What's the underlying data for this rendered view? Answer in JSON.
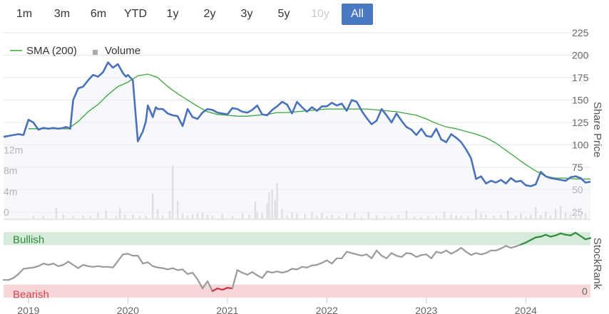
{
  "range_selector": {
    "buttons": [
      {
        "label": "1m",
        "state": "normal"
      },
      {
        "label": "3m",
        "state": "normal"
      },
      {
        "label": "6m",
        "state": "normal"
      },
      {
        "label": "YTD",
        "state": "normal"
      },
      {
        "label": "1y",
        "state": "normal"
      },
      {
        "label": "2y",
        "state": "normal"
      },
      {
        "label": "3y",
        "state": "normal"
      },
      {
        "label": "5y",
        "state": "normal"
      },
      {
        "label": "10y",
        "state": "disabled"
      },
      {
        "label": "All",
        "state": "active"
      }
    ]
  },
  "colors": {
    "price_line": "#4a72b8",
    "price_fill": "#eef2fa",
    "sma_line": "#3aa63a",
    "volume_bar": "#c8c8c8",
    "bullish_zone": "#d6ebd9",
    "bearish_zone": "#f6d6d9",
    "bullish_text": "#2e8b3a",
    "bearish_text": "#d0454f",
    "rank_neutral": "#9a9a9a",
    "rank_bull": "#2e8b3a",
    "rank_bear": "#c8323e",
    "active_button": "#4a78c2"
  },
  "chart_data": [
    {
      "type": "line",
      "name": "price-panel",
      "legend": [
        {
          "label": "SMA (200)",
          "icon": "line-swatch"
        },
        {
          "label": "Volume",
          "icon": "square-swatch"
        }
      ],
      "y_axis_title": "Share Price",
      "y_ticks": [
        "225",
        "200",
        "175",
        "150",
        "125",
        "100",
        "75",
        "50",
        "25"
      ],
      "ylim": [
        25,
        225
      ],
      "volume_ticks": [
        "12m",
        "8m",
        "4m",
        "0"
      ],
      "volume_ylim": [
        0,
        16
      ],
      "x_ticks": [
        "2019",
        "2020",
        "2021",
        "2022",
        "2023",
        "2024"
      ],
      "xlim": [
        2018.75,
        2024.65
      ],
      "series": [
        {
          "name": "Price",
          "x": [
            2018.75,
            2018.8,
            2018.85,
            2018.9,
            2018.95,
            2019.0,
            2019.05,
            2019.1,
            2019.15,
            2019.2,
            2019.25,
            2019.3,
            2019.35,
            2019.38,
            2019.42,
            2019.45,
            2019.5,
            2019.55,
            2019.6,
            2019.65,
            2019.7,
            2019.75,
            2019.8,
            2019.85,
            2019.9,
            2019.95,
            2019.98,
            2020.0,
            2020.05,
            2020.1,
            2020.15,
            2020.18,
            2020.2,
            2020.22,
            2020.25,
            2020.28,
            2020.3,
            2020.35,
            2020.4,
            2020.45,
            2020.5,
            2020.55,
            2020.6,
            2020.65,
            2020.7,
            2020.75,
            2020.8,
            2020.85,
            2020.9,
            2020.95,
            2021.0,
            2021.05,
            2021.1,
            2021.15,
            2021.2,
            2021.25,
            2021.3,
            2021.35,
            2021.4,
            2021.45,
            2021.5,
            2021.55,
            2021.6,
            2021.65,
            2021.7,
            2021.75,
            2021.8,
            2021.85,
            2021.9,
            2021.95,
            2022.0,
            2022.05,
            2022.1,
            2022.15,
            2022.2,
            2022.25,
            2022.3,
            2022.35,
            2022.4,
            2022.45,
            2022.5,
            2022.55,
            2022.6,
            2022.65,
            2022.7,
            2022.75,
            2022.8,
            2022.85,
            2022.9,
            2022.95,
            2023.0,
            2023.05,
            2023.1,
            2023.15,
            2023.2,
            2023.25,
            2023.3,
            2023.35,
            2023.4,
            2023.45,
            2023.5,
            2023.55,
            2023.6,
            2023.65,
            2023.7,
            2023.75,
            2023.8,
            2023.85,
            2023.9,
            2023.95,
            2024.0,
            2024.05,
            2024.1,
            2024.15,
            2024.2,
            2024.25,
            2024.3,
            2024.35,
            2024.4,
            2024.45,
            2024.5,
            2024.55,
            2024.6,
            2024.65
          ],
          "y": [
            109,
            110,
            111,
            112,
            111,
            128,
            125,
            117,
            119,
            118,
            119,
            118,
            119,
            120,
            118,
            150,
            163,
            165,
            172,
            178,
            176,
            181,
            192,
            186,
            190,
            180,
            176,
            178,
            172,
            104,
            115,
            126,
            144,
            139,
            131,
            142,
            140,
            140,
            135,
            133,
            132,
            121,
            140,
            131,
            129,
            136,
            140,
            139,
            136,
            135,
            134,
            141,
            140,
            137,
            136,
            139,
            144,
            134,
            133,
            139,
            143,
            148,
            145,
            135,
            148,
            142,
            137,
            142,
            138,
            143,
            143,
            147,
            144,
            146,
            138,
            150,
            148,
            138,
            130,
            123,
            127,
            140,
            133,
            125,
            135,
            127,
            120,
            117,
            111,
            118,
            110,
            109,
            118,
            106,
            103,
            112,
            108,
            103,
            95,
            85,
            62,
            65,
            57,
            60,
            58,
            61,
            57,
            63,
            59,
            60,
            55,
            54,
            56,
            70,
            65,
            63,
            62,
            61,
            60,
            64,
            65,
            63,
            58,
            59
          ],
          "color_key": "price_line"
        },
        {
          "name": "SMA (200)",
          "x": [
            2019.0,
            2019.2,
            2019.4,
            2019.5,
            2019.6,
            2019.7,
            2019.8,
            2019.9,
            2020.0,
            2020.1,
            2020.2,
            2020.3,
            2020.4,
            2020.5,
            2020.6,
            2020.7,
            2020.8,
            2020.9,
            2021.0,
            2021.1,
            2021.2,
            2021.3,
            2021.4,
            2021.5,
            2021.6,
            2021.7,
            2021.8,
            2021.9,
            2022.0,
            2022.1,
            2022.2,
            2022.3,
            2022.4,
            2022.5,
            2022.6,
            2022.7,
            2022.8,
            2022.9,
            2023.0,
            2023.1,
            2023.2,
            2023.3,
            2023.4,
            2023.5,
            2023.6,
            2023.7,
            2023.8,
            2023.9,
            2024.0,
            2024.1,
            2024.2,
            2024.3,
            2024.4,
            2024.5,
            2024.65
          ],
          "y": [
            118,
            118,
            118,
            126,
            137,
            145,
            156,
            165,
            170,
            177,
            179,
            175,
            165,
            157,
            150,
            143,
            137,
            134,
            133,
            132,
            132,
            133,
            134,
            136,
            136,
            137,
            138,
            139,
            140,
            140,
            140,
            140,
            140,
            139,
            138,
            137,
            135,
            133,
            129,
            124,
            120,
            118,
            115,
            112,
            108,
            102,
            94,
            86,
            78,
            71,
            65,
            63,
            63,
            62,
            62
          ],
          "color_key": "sma_line"
        }
      ],
      "volume": {
        "x": [
          2019.05,
          2019.15,
          2019.28,
          2019.35,
          2019.45,
          2019.55,
          2019.62,
          2019.7,
          2019.78,
          2019.88,
          2019.92,
          2019.97,
          2020.05,
          2020.12,
          2020.18,
          2020.25,
          2020.3,
          2020.35,
          2020.42,
          2020.45,
          2020.5,
          2020.55,
          2020.6,
          2020.65,
          2020.7,
          2020.75,
          2020.8,
          2020.85,
          2020.95,
          2021.05,
          2021.15,
          2021.22,
          2021.28,
          2021.3,
          2021.35,
          2021.4,
          2021.42,
          2021.45,
          2021.48,
          2021.5,
          2021.55,
          2021.6,
          2021.65,
          2021.7,
          2021.78,
          2021.85,
          2021.9,
          2021.95,
          2022.0,
          2022.05,
          2022.12,
          2022.2,
          2022.28,
          2022.35,
          2022.42,
          2022.5,
          2022.58,
          2022.65,
          2022.72,
          2022.8,
          2022.88,
          2022.95,
          2023.02,
          2023.1,
          2023.18,
          2023.25,
          2023.3,
          2023.35,
          2023.42,
          2023.5,
          2023.55,
          2023.6,
          2023.68,
          2023.75,
          2023.82,
          2023.9,
          2023.95,
          2024.0,
          2024.05,
          2024.1,
          2024.15,
          2024.2,
          2024.25,
          2024.3,
          2024.35,
          2024.4,
          2024.45,
          2024.5,
          2024.55,
          2024.6
        ],
        "values": [
          0.6,
          0.5,
          2.0,
          0.8,
          0.5,
          0.6,
          0.4,
          1.1,
          1.6,
          0.5,
          2.1,
          0.7,
          0.8,
          0.4,
          0.5,
          4.8,
          1.8,
          0.6,
          1.5,
          10.2,
          3.4,
          1.0,
          0.6,
          0.8,
          1.0,
          1.2,
          0.7,
          0.6,
          0.9,
          0.5,
          1.0,
          0.8,
          3.3,
          1.2,
          1.1,
          2.9,
          5.0,
          5.5,
          3.6,
          6.8,
          1.9,
          0.6,
          1.3,
          1.0,
          0.9,
          1.2,
          0.6,
          1.1,
          0.4,
          0.8,
          0.4,
          0.9,
          1.1,
          0.3,
          1.3,
          0.6,
          0.4,
          0.5,
          0.7,
          1.5,
          0.4,
          0.3,
          0.5,
          0.6,
          1.4,
          0.9,
          0.6,
          0.5,
          0.4,
          1.9,
          1.0,
          0.7,
          0.6,
          0.8,
          1.5,
          0.6,
          1.0,
          0.4,
          0.8,
          2.2,
          0.7,
          1.3,
          0.6,
          1.8,
          2.4,
          1.2,
          0.9,
          1.6,
          0.7,
          1.0
        ],
        "color_key": "volume_bar"
      }
    },
    {
      "type": "line",
      "name": "stockrank-panel",
      "y_axis_title": "StockRank",
      "y_ticks": [
        "0"
      ],
      "ylim": [
        0,
        100
      ],
      "zones": [
        {
          "label": "Bullish",
          "from": 80,
          "to": 100,
          "color_key": "bullish_zone",
          "text_color_key": "bullish_text"
        },
        {
          "label": "Bearish",
          "from": 0,
          "to": 20,
          "color_key": "bearish_zone",
          "text_color_key": "bearish_text"
        }
      ],
      "x": [
        2018.75,
        2018.8,
        2018.85,
        2018.9,
        2018.95,
        2019.0,
        2019.05,
        2019.1,
        2019.15,
        2019.2,
        2019.25,
        2019.3,
        2019.35,
        2019.4,
        2019.45,
        2019.5,
        2019.55,
        2019.6,
        2019.65,
        2019.7,
        2019.75,
        2019.8,
        2019.85,
        2019.9,
        2019.95,
        2020.0,
        2020.05,
        2020.1,
        2020.15,
        2020.2,
        2020.25,
        2020.3,
        2020.35,
        2020.4,
        2020.45,
        2020.5,
        2020.55,
        2020.6,
        2020.65,
        2020.7,
        2020.75,
        2020.8,
        2020.85,
        2020.9,
        2020.95,
        2021.0,
        2021.05,
        2021.1,
        2021.15,
        2021.2,
        2021.25,
        2021.3,
        2021.35,
        2021.4,
        2021.45,
        2021.5,
        2021.55,
        2021.6,
        2021.65,
        2021.7,
        2021.75,
        2021.8,
        2021.85,
        2021.9,
        2021.95,
        2022.0,
        2022.05,
        2022.1,
        2022.15,
        2022.2,
        2022.25,
        2022.3,
        2022.35,
        2022.4,
        2022.45,
        2022.5,
        2022.55,
        2022.6,
        2022.65,
        2022.7,
        2022.75,
        2022.8,
        2022.85,
        2022.9,
        2022.95,
        2023.0,
        2023.05,
        2023.1,
        2023.15,
        2023.2,
        2023.25,
        2023.3,
        2023.35,
        2023.4,
        2023.45,
        2023.5,
        2023.55,
        2023.6,
        2023.65,
        2023.7,
        2023.75,
        2023.8,
        2023.85,
        2023.9,
        2023.95,
        2024.0,
        2024.05,
        2024.1,
        2024.15,
        2024.2,
        2024.25,
        2024.3,
        2024.35,
        2024.4,
        2024.45,
        2024.5,
        2024.55,
        2024.6,
        2024.65
      ],
      "values": [
        27,
        27,
        30,
        36,
        44,
        45,
        46,
        48,
        52,
        50,
        52,
        48,
        50,
        55,
        50,
        45,
        50,
        48,
        47,
        48,
        47,
        47,
        46,
        56,
        66,
        67,
        64,
        64,
        52,
        54,
        48,
        46,
        45,
        43,
        45,
        42,
        43,
        36,
        38,
        28,
        14,
        25,
        10,
        14,
        12,
        15,
        14,
        42,
        38,
        35,
        39,
        34,
        30,
        40,
        38,
        40,
        38,
        40,
        44,
        43,
        47,
        46,
        49,
        50,
        53,
        57,
        52,
        60,
        60,
        70,
        68,
        66,
        64,
        66,
        60,
        72,
        64,
        60,
        68,
        64,
        62,
        68,
        67,
        62,
        65,
        66,
        60,
        70,
        68,
        72,
        67,
        71,
        76,
        70,
        65,
        68,
        66,
        68,
        72,
        72,
        75,
        79,
        76,
        78,
        81,
        84,
        88,
        92,
        93,
        96,
        93,
        95,
        98,
        96,
        95,
        99,
        94,
        89,
        91
      ]
    }
  ]
}
